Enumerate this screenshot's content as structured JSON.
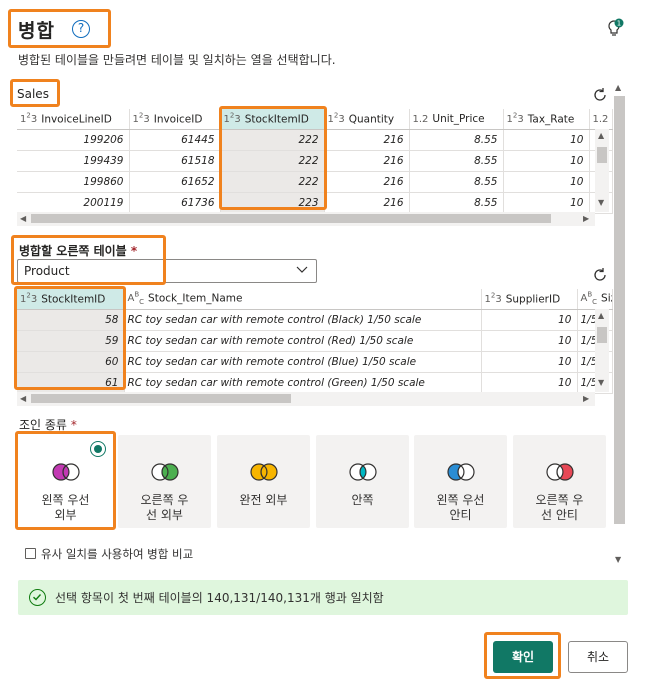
{
  "dialog": {
    "title": "병합",
    "help_icon": "question-circle-icon",
    "subtitle": "병합된 테이블을 만들려면 테이블 및 일치하는 열을 선택합니다."
  },
  "top_table": {
    "name": "Sales",
    "columns": [
      {
        "type": "1²3",
        "name": "InvoiceLineID"
      },
      {
        "type": "1²3",
        "name": "InvoiceID"
      },
      {
        "type": "1²3",
        "name": "StockItemID"
      },
      {
        "type": "1²3",
        "name": "Quantity"
      },
      {
        "type": "1.2",
        "name": "Unit_Price"
      },
      {
        "type": "1²3",
        "name": "Tax_Rate"
      },
      {
        "type": "1.2",
        "name": ""
      }
    ],
    "rows": [
      [
        "199206",
        "61445",
        "222",
        "216",
        "8.55",
        "10"
      ],
      [
        "199439",
        "61518",
        "222",
        "216",
        "8.55",
        "10"
      ],
      [
        "199860",
        "61652",
        "222",
        "216",
        "8.55",
        "10"
      ],
      [
        "200119",
        "61736",
        "223",
        "216",
        "8.55",
        "10"
      ]
    ],
    "selected_column": "StockItemID"
  },
  "right_table": {
    "label": "병합할 오른쪽 테이블",
    "required_mark": "*",
    "selected": "Product",
    "columns": [
      {
        "type": "1²3",
        "name": "StockItemID"
      },
      {
        "type": "ABC",
        "name": "Stock_Item_Name"
      },
      {
        "type": "1²3",
        "name": "SupplierID"
      },
      {
        "type": "ABC",
        "name": "Siz"
      }
    ],
    "rows": [
      [
        "58",
        "RC toy sedan car with remote control (Black) 1/50 scale",
        "10",
        "1/5"
      ],
      [
        "59",
        "RC toy sedan car with remote control (Red) 1/50 scale",
        "10",
        "1/5"
      ],
      [
        "60",
        "RC toy sedan car with remote control (Blue) 1/50 scale",
        "10",
        "1/5"
      ],
      [
        "61",
        "RC toy sedan car with remote control (Green) 1/50 scale",
        "10",
        "1/5"
      ]
    ],
    "selected_column": "StockItemID"
  },
  "join": {
    "label": "조인 종류",
    "required_mark": "*",
    "options": [
      {
        "line1": "왼쪽 우선",
        "line2": "외부",
        "icon": "venn-left-outer-icon",
        "left": "#c239b3",
        "right": "#ffffff",
        "overlap": "#c239b3"
      },
      {
        "line1": "오른쪽 우",
        "line2": "선 외부",
        "icon": "venn-right-outer-icon",
        "left": "#ffffff",
        "right": "#4caf50",
        "overlap": "#4caf50"
      },
      {
        "line1": "완전 외부",
        "line2": "",
        "icon": "venn-full-outer-icon",
        "left": "#f7b500",
        "right": "#f7b500",
        "overlap": "#f7b500"
      },
      {
        "line1": "안쪽",
        "line2": "",
        "icon": "venn-inner-icon",
        "left": "#ffffff",
        "right": "#ffffff",
        "overlap": "#00b7c3"
      },
      {
        "line1": "왼쪽 우선",
        "line2": "안티",
        "icon": "venn-left-anti-icon",
        "left": "#2a8dd4",
        "right": "#ffffff",
        "overlap": "#ffffff"
      },
      {
        "line1": "오른쪽 우",
        "line2": "선 안티",
        "icon": "venn-right-anti-icon",
        "left": "#ffffff",
        "right": "#e74856",
        "overlap": "#ffffff"
      }
    ],
    "selected_index": 0
  },
  "fuzzy": {
    "label": "유사 일치를 사용하여 병합 비교",
    "checked": false
  },
  "status": {
    "text": "선택 항목이 첫 번째 테이블의 140,131/140,131개 행과 일치함",
    "icon": "check-circle-icon"
  },
  "buttons": {
    "ok": "확인",
    "cancel": "취소"
  },
  "colors": {
    "accent": "#117865",
    "highlight": "#f0821e",
    "selected_header": "#cfeae7",
    "success_bg": "#dff6dd"
  }
}
